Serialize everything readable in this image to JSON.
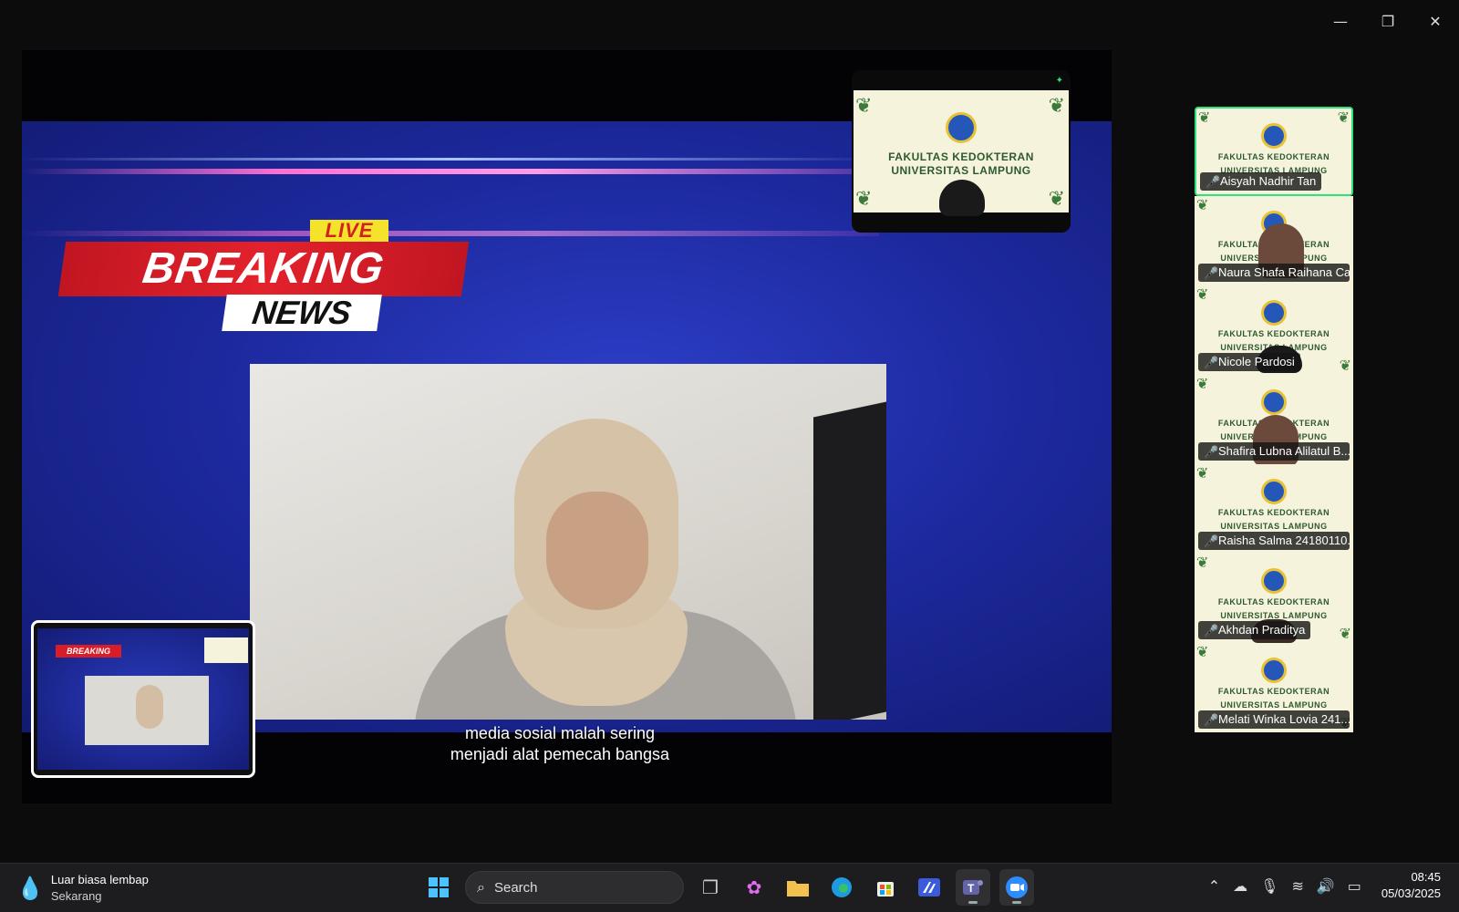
{
  "window_controls": {
    "minimize": "—",
    "restore": "❐",
    "close": "✕"
  },
  "shared_screen": {
    "banner": {
      "live": "LIVE",
      "breaking": "BREAKING",
      "news": "NEWS"
    },
    "caption_line1": "media sosial malah sering",
    "caption_line2": "menjadi alat pemecah bangsa",
    "logo_line1": "FAKULTAS KEDOKTERAN",
    "logo_line2": "UNIVERSITAS LAMPUNG"
  },
  "participants": [
    {
      "name": "Aisyah Nadhir Tan",
      "active": true
    },
    {
      "name": "Naura Shafa Raihana Ca..."
    },
    {
      "name": "Nicole Pardosi"
    },
    {
      "name": "Shafira Lubna Alilatul B..."
    },
    {
      "name": "Raisha Salma 24180110..."
    },
    {
      "name": "Akhdan Praditya"
    },
    {
      "name": "Melati Winka Lovia 241..."
    }
  ],
  "tile_logo": {
    "line1": "FAKULTAS KEDOKTERAN",
    "line2": "UNIVERSITAS LAMPUNG"
  },
  "taskbar": {
    "weather_title": "Luar biasa lembap",
    "weather_sub": "Sekarang",
    "search_placeholder": "Search",
    "time": "08:45",
    "date": "05/03/2025"
  },
  "colors": {
    "accent_active": "#2ee37b",
    "banner_red": "#e3222c",
    "banner_blue": "#1d2aa0"
  }
}
